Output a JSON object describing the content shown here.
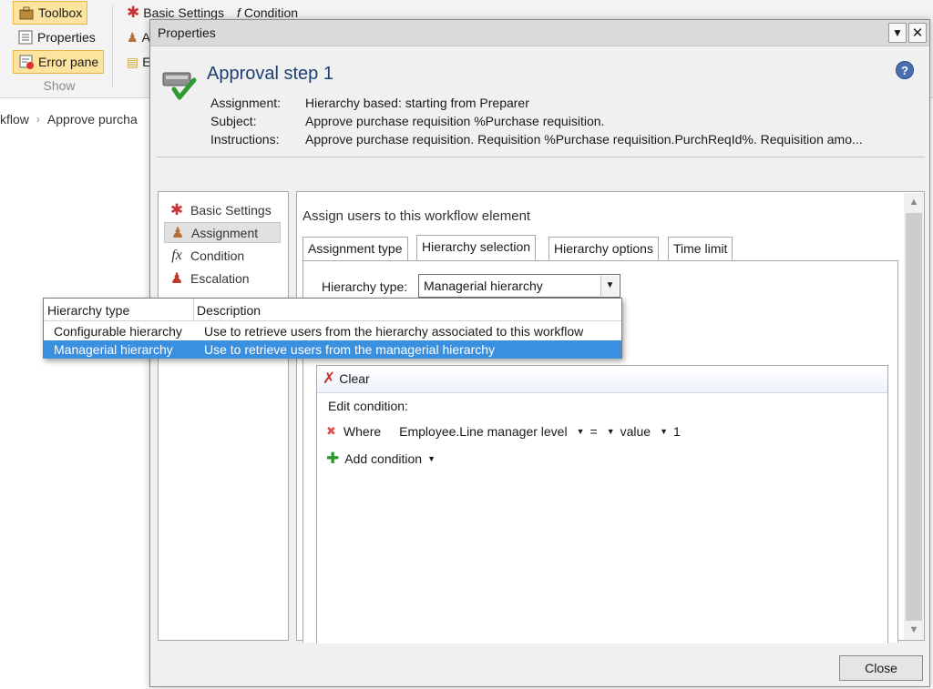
{
  "ribbon": {
    "toolbox_label": "Toolbox",
    "properties_label": "Properties",
    "error_pane_label": "Error pane",
    "group_label": "Show",
    "basic_settings_label": "Basic Settings",
    "condition_label": "Condition",
    "partial_a": "A",
    "partial_e": "E"
  },
  "breadcrumb": {
    "item1": "kflow",
    "item2": "Approve purcha"
  },
  "dialog": {
    "title": "Properties",
    "step_title": "Approval step 1",
    "meta": [
      {
        "label": "Assignment:",
        "value": "Hierarchy based: starting from Preparer"
      },
      {
        "label": "Subject:",
        "value": "Approve purchase requisition %Purchase requisition."
      },
      {
        "label": "Instructions:",
        "value": "Approve purchase requisition. Requisition %Purchase requisition.PurchReqId%. Requisition amo..."
      }
    ],
    "nav": [
      {
        "label": "Basic Settings"
      },
      {
        "label": "Assignment"
      },
      {
        "label": "Condition"
      },
      {
        "label": "Escalation"
      }
    ],
    "main_heading": "Assign users to this workflow element",
    "tabs": [
      {
        "label": "Assignment type"
      },
      {
        "label": "Hierarchy selection"
      },
      {
        "label": "Hierarchy options"
      },
      {
        "label": "Time limit"
      }
    ],
    "hierarchy_type_label": "Hierarchy type:",
    "hierarchy_type_value": "Managerial hierarchy",
    "condition": {
      "clear_label": "Clear",
      "edit_label": "Edit condition:",
      "where_label": "Where",
      "field": "Employee.Line manager level",
      "operator": "=",
      "value_type": "value",
      "value": "1",
      "add_label": "Add condition"
    },
    "close_label": "Close"
  },
  "popup": {
    "headers": [
      "Hierarchy type",
      "Description"
    ],
    "rows": [
      {
        "type": "Configurable hierarchy",
        "desc": "Use to retrieve users from the hierarchy associated to this workflow"
      },
      {
        "type": "Managerial hierarchy",
        "desc": "Use to retrieve users from the managerial hierarchy"
      }
    ],
    "selected_index": 1
  },
  "colors": {
    "accent": "#3a8fde",
    "title_blue": "#1e3f73",
    "ribbon_active": "#fde49e"
  }
}
